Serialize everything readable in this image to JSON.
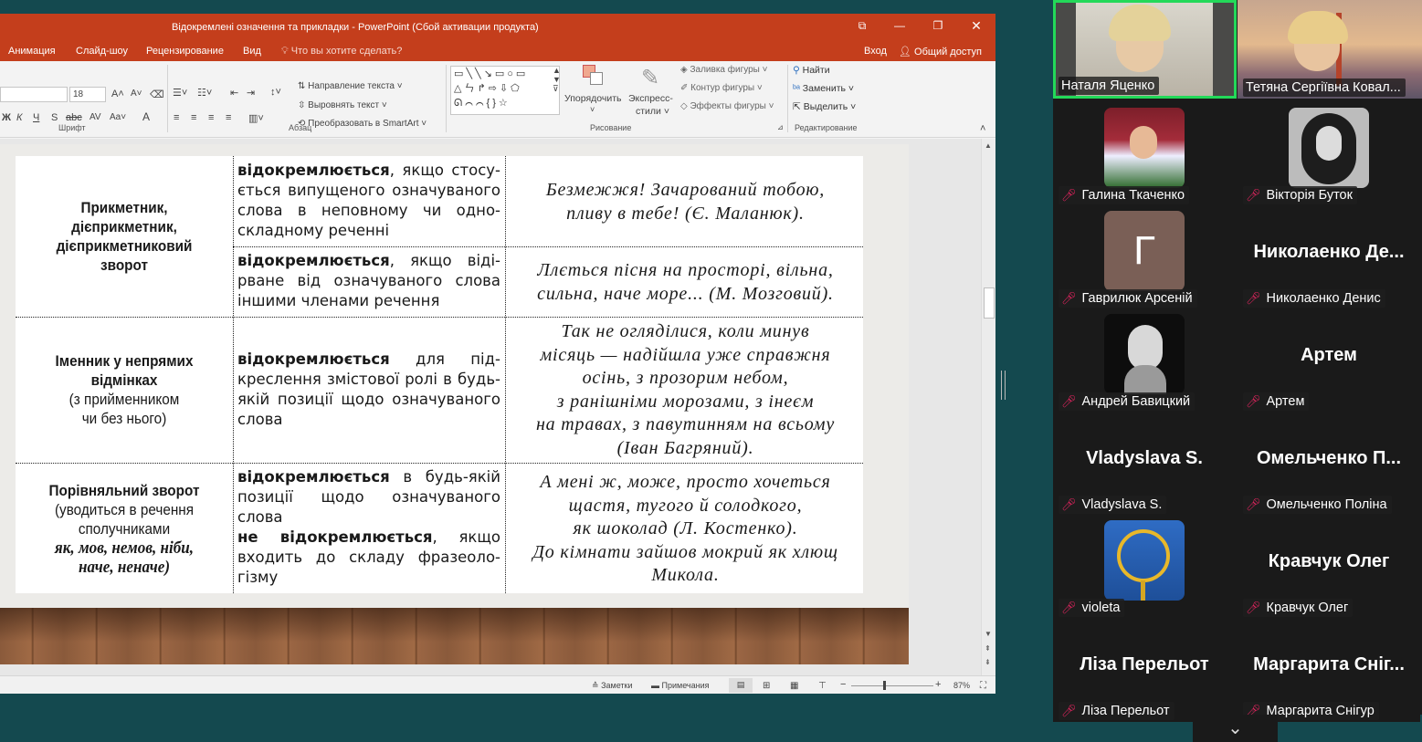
{
  "window": {
    "title": "Відокремлені означення та прикладки - PowerPoint (Сбой активации продукта)",
    "tabs": [
      "Анимация",
      "Слайд-шоу",
      "Рецензирование",
      "Вид"
    ],
    "tell_me": "Что вы хотите сделать?",
    "login": "Вход",
    "share": "Общий доступ"
  },
  "ribbon": {
    "font_size": "18",
    "groups": {
      "font": "Шрифт",
      "paragraph": "Абзац",
      "drawing": "Рисование",
      "editing": "Редактирование"
    },
    "paragraph": {
      "text_direction": "Направление текста",
      "align_text": "Выровнять текст",
      "smartart": "Преобразовать в SmartArt"
    },
    "drawing": {
      "arrange": "Упорядочить",
      "quick_styles_1": "Экспресс-",
      "quick_styles_2": "стили",
      "fill": "Заливка фигуры",
      "outline": "Контур фигуры",
      "effects": "Эффекты фигуры"
    },
    "editing": {
      "find": "Найти",
      "replace": "Заменить",
      "select": "Выделить"
    }
  },
  "slide": {
    "rows": [
      {
        "c1_bold": [
          "Прикметник,",
          "дієприкметник,",
          "дієприкметниковий",
          "зворот"
        ],
        "sub": [
          {
            "c2_bold": "відокремлюється",
            "c2_rest": ", якщо стосу-ється випущеного означуваного слова в неповному чи одно-складному реченні",
            "c3": [
              "Безмежжя! Зачарований тобою,",
              "пливу в тебе! (Є. Маланюк)."
            ]
          },
          {
            "c2_bold": "відокремлюється",
            "c2_rest": ", якщо віді-рване від означуваного слова іншими членами речення",
            "c3": [
              "Ллється пісня на просторі, вільна,",
              "сильна, наче море... (М. Мозговий)."
            ]
          }
        ]
      },
      {
        "c1_bold": [
          "Іменник у непрямих",
          "відмінках"
        ],
        "c1_normal": [
          "(з прийменником",
          "чи без нього)"
        ],
        "c2_bold": "відокремлюється",
        "c2_rest": " для під-креслення змістової ролі в будь-якій позиції щодо означуваного слова",
        "c3": [
          "Так не огляділися, коли минув",
          "місяць — надійшла уже справжня",
          "осінь, з прозорим небом,",
          "з ранішніми морозами, з інеєм",
          "на травах, з павутинням на всьому",
          "(Іван Багряний)."
        ]
      },
      {
        "c1_bold": [
          "Порівняльний зворот"
        ],
        "c1_normal": [
          "(уводиться в речення",
          "сполучниками"
        ],
        "c1_italic": [
          "як, мов, немов, ніби,",
          "наче, неначе)"
        ],
        "c2_bold": "відокремлюється",
        "c2_rest": " в будь-якій позиції щодо означуваного слова",
        "c2_bold2": "не відокремлюється",
        "c2_rest2": ", якщо входить до складу фразеоло-гізму",
        "c3": [
          "А мені ж, може, просто хочеться",
          "щастя, тугого й солодкого,",
          "як шоколад (Л. Костенко).",
          "До кімнати зайшов мокрий як хлющ",
          "Микола."
        ]
      }
    ]
  },
  "statusbar": {
    "notes": "Заметки",
    "comments": "Примечания",
    "zoom": "87%"
  },
  "participants": [
    {
      "name": "Наталя Яценко",
      "active": true,
      "video": true
    },
    {
      "name": "Тетяна Сергіївна Ковал...",
      "video": true
    },
    {
      "name": "Галина Ткаченко",
      "muted": true,
      "avatar": "photo"
    },
    {
      "name": "Вікторія Буток",
      "muted": true,
      "avatar": "photo"
    },
    {
      "name": "Гаврилюк Арсеній",
      "muted": true,
      "letter": "Г"
    },
    {
      "name": "Николаенко Денис",
      "muted": true,
      "big": "Николаенко Де..."
    },
    {
      "name": "Андрей Бавицкий",
      "muted": true,
      "avatar": "photo"
    },
    {
      "name": "Артем",
      "muted": true,
      "big": "Артем"
    },
    {
      "name": "Vladyslava S.",
      "muted": true,
      "big": "Vladyslava S."
    },
    {
      "name": "Омельченко Поліна",
      "muted": true,
      "big": "Омельченко П..."
    },
    {
      "name": "violeta",
      "muted": true,
      "avatar": "sign"
    },
    {
      "name": "Кравчук Олег",
      "muted": true,
      "big": "Кравчук Олег"
    },
    {
      "name": "Ліза Перельот",
      "muted": true,
      "big": "Ліза Перельот"
    },
    {
      "name": "Маргарита Снігур",
      "muted": true,
      "big": "Маргарита Сніг..."
    }
  ]
}
